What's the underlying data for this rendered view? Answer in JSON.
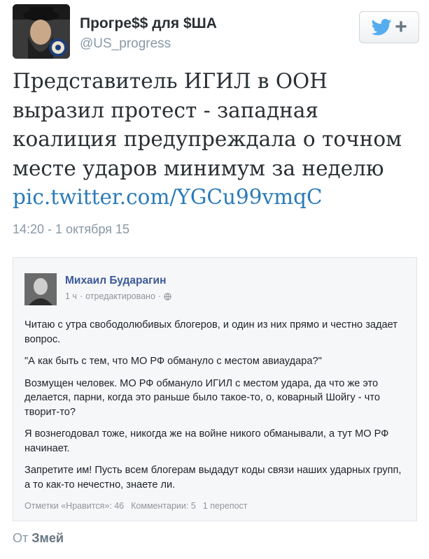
{
  "tweet": {
    "author_name": "Прогре$$ для $ША",
    "author_handle": "@US_progress",
    "follow_button": {
      "icon": "twitter-bird-icon",
      "plus": "+"
    },
    "text": "Представитель ИГИЛ в ООН выразил протест - западная коалиция предупреждала о точном месте ударов минимум за неделю",
    "link": "pic.twitter.com/YGCu99vmqC",
    "timestamp": "14:20 - 1 октября 15",
    "colors": {
      "link": "#2b7bb9",
      "muted": "#8899a6",
      "bird": "#55acee"
    }
  },
  "embedded_post": {
    "author": "Михаил Бударагин",
    "time": "1 ч",
    "edited": "отредактировано",
    "globe_icon": "globe-icon",
    "paragraphs": [
      "Читаю с утра свободолюбивых блогеров, и один из них прямо и честно задает вопрос.",
      "\"А как быть с тем, что МО РФ обмануло с местом авиаудара?\"",
      "Возмущен человек. МО РФ обмануло ИГИЛ с местом удара, да что же это делается, парни, когда это раньше было такое-то, о, коварный Шойгу - что творит-то?",
      "Я вознегодовал тоже, никогда же на войне никого обманывали, а тут МО РФ начинает.",
      "Запретите им! Пусть всем блогерам выдадут коды связи наших ударных групп, а то как-то нечестно, знаете ли."
    ],
    "footer": {
      "likes": "Отметки «Нравится»: 46",
      "comments": "Комментарии: 5",
      "shares": "1 перепост"
    },
    "colors": {
      "author": "#3b5998",
      "muted": "#90949c"
    }
  },
  "source": {
    "prefix": "От",
    "name": "Змей"
  }
}
